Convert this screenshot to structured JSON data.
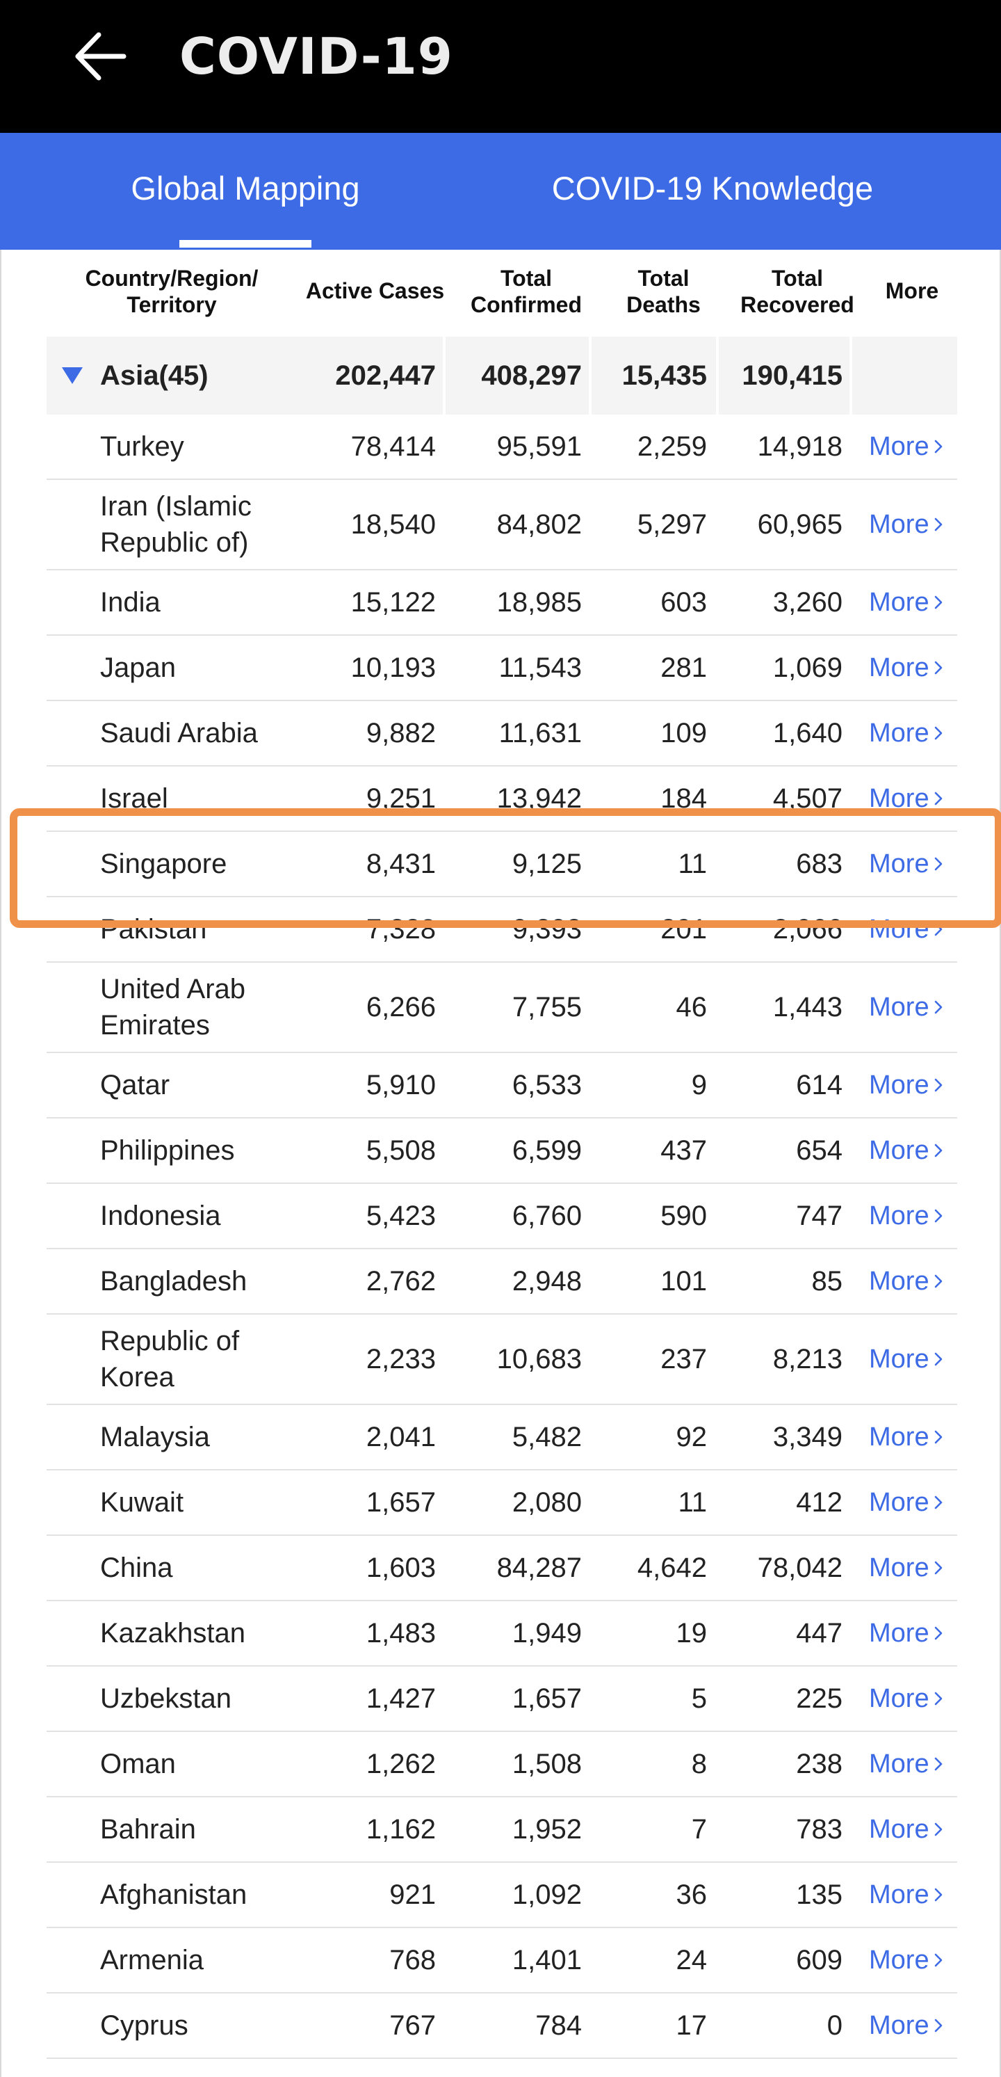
{
  "header": {
    "title": "COVID-19"
  },
  "tabs": [
    {
      "label": "Global Mapping",
      "active": true
    },
    {
      "label": "COVID-19 Knowledge",
      "active": false
    }
  ],
  "columns": {
    "country": "Country/Region/ Territory",
    "active": "Active Cases",
    "confirmed": "Total Confirmed",
    "deaths": "Total Deaths",
    "recovered": "Total Recovered",
    "more": "More"
  },
  "group": {
    "name": "Asia(45)",
    "active": "202,447",
    "confirmed": "408,297",
    "deaths": "15,435",
    "recovered": "190,415"
  },
  "more_label": "More",
  "highlight_color": "#f0914a",
  "accent_color": "#3d6be6",
  "rows": [
    {
      "name": "Turkey",
      "active": "78,414",
      "confirmed": "95,591",
      "deaths": "2,259",
      "recovered": "14,918"
    },
    {
      "name": "Iran (Islamic Republic of)",
      "active": "18,540",
      "confirmed": "84,802",
      "deaths": "5,297",
      "recovered": "60,965"
    },
    {
      "name": "India",
      "active": "15,122",
      "confirmed": "18,985",
      "deaths": "603",
      "recovered": "3,260"
    },
    {
      "name": "Japan",
      "active": "10,193",
      "confirmed": "11,543",
      "deaths": "281",
      "recovered": "1,069"
    },
    {
      "name": "Saudi Arabia",
      "active": "9,882",
      "confirmed": "11,631",
      "deaths": "109",
      "recovered": "1,640"
    },
    {
      "name": "Israel",
      "active": "9,251",
      "confirmed": "13,942",
      "deaths": "184",
      "recovered": "4,507"
    },
    {
      "name": "Singapore",
      "active": "8,431",
      "confirmed": "9,125",
      "deaths": "11",
      "recovered": "683"
    },
    {
      "name": "Pakistan",
      "active": "7,328",
      "confirmed": "9,393",
      "deaths": "201",
      "recovered": "2,066"
    },
    {
      "name": "United Arab Emirates",
      "active": "6,266",
      "confirmed": "7,755",
      "deaths": "46",
      "recovered": "1,443"
    },
    {
      "name": "Qatar",
      "active": "5,910",
      "confirmed": "6,533",
      "deaths": "9",
      "recovered": "614"
    },
    {
      "name": "Philippines",
      "active": "5,508",
      "confirmed": "6,599",
      "deaths": "437",
      "recovered": "654"
    },
    {
      "name": "Indonesia",
      "active": "5,423",
      "confirmed": "6,760",
      "deaths": "590",
      "recovered": "747"
    },
    {
      "name": "Bangladesh",
      "active": "2,762",
      "confirmed": "2,948",
      "deaths": "101",
      "recovered": "85"
    },
    {
      "name": "Republic of Korea",
      "active": "2,233",
      "confirmed": "10,683",
      "deaths": "237",
      "recovered": "8,213"
    },
    {
      "name": "Malaysia",
      "active": "2,041",
      "confirmed": "5,482",
      "deaths": "92",
      "recovered": "3,349"
    },
    {
      "name": "Kuwait",
      "active": "1,657",
      "confirmed": "2,080",
      "deaths": "11",
      "recovered": "412"
    },
    {
      "name": "China",
      "active": "1,603",
      "confirmed": "84,287",
      "deaths": "4,642",
      "recovered": "78,042"
    },
    {
      "name": "Kazakhstan",
      "active": "1,483",
      "confirmed": "1,949",
      "deaths": "19",
      "recovered": "447"
    },
    {
      "name": "Uzbekstan",
      "active": "1,427",
      "confirmed": "1,657",
      "deaths": "5",
      "recovered": "225"
    },
    {
      "name": "Oman",
      "active": "1,262",
      "confirmed": "1,508",
      "deaths": "8",
      "recovered": "238"
    },
    {
      "name": "Bahrain",
      "active": "1,162",
      "confirmed": "1,952",
      "deaths": "7",
      "recovered": "783"
    },
    {
      "name": "Afghanistan",
      "active": "921",
      "confirmed": "1,092",
      "deaths": "36",
      "recovered": "135"
    },
    {
      "name": "Armenia",
      "active": "768",
      "confirmed": "1,401",
      "deaths": "24",
      "recovered": "609"
    },
    {
      "name": "Cyprus",
      "active": "767",
      "confirmed": "784",
      "deaths": "17",
      "recovered": "0"
    }
  ]
}
